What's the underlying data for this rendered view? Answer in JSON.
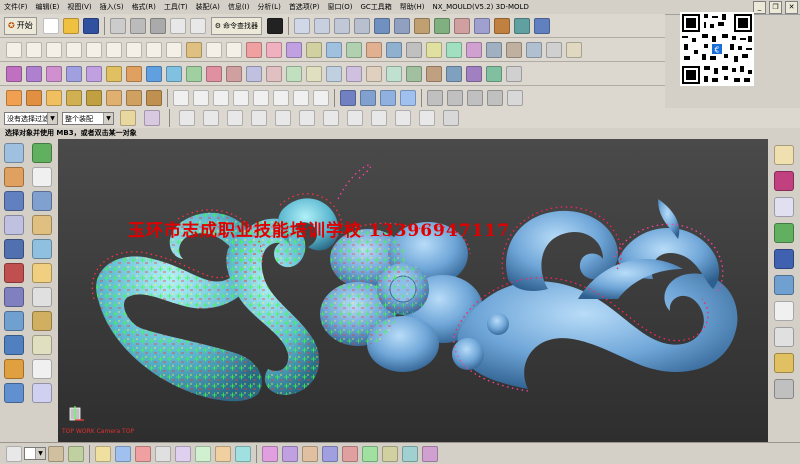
{
  "menubar": {
    "items": [
      "文件(F)",
      "编辑(E)",
      "视图(V)",
      "插入(S)",
      "格式(R)",
      "工具(T)",
      "装配(A)",
      "信息(I)",
      "分析(L)",
      "首选项(P)",
      "窗口(O)",
      "GC工具箱",
      "帮助(H)"
    ],
    "app_title": "NX_MOULD(V5.2)  3D-MOLD"
  },
  "toolbar": {
    "start_label": "开始",
    "command_finder_label": "命令查找器"
  },
  "selection": {
    "filter_label": "没有选择过滤器",
    "scope_label": "整个装配"
  },
  "cue_line": "选择对象并使用 MB3，或者双击某一对象",
  "viewport": {
    "watermark": "玉环市志成职业技能培训学校   13396947117",
    "camera_label": "TOP WORK Camera TOP"
  },
  "colors": {
    "model_body": "#6fa6d8",
    "model_highlight": "#8fd8f0",
    "watermark": "#e00000",
    "viewport_bg": "#3a3a3a"
  }
}
